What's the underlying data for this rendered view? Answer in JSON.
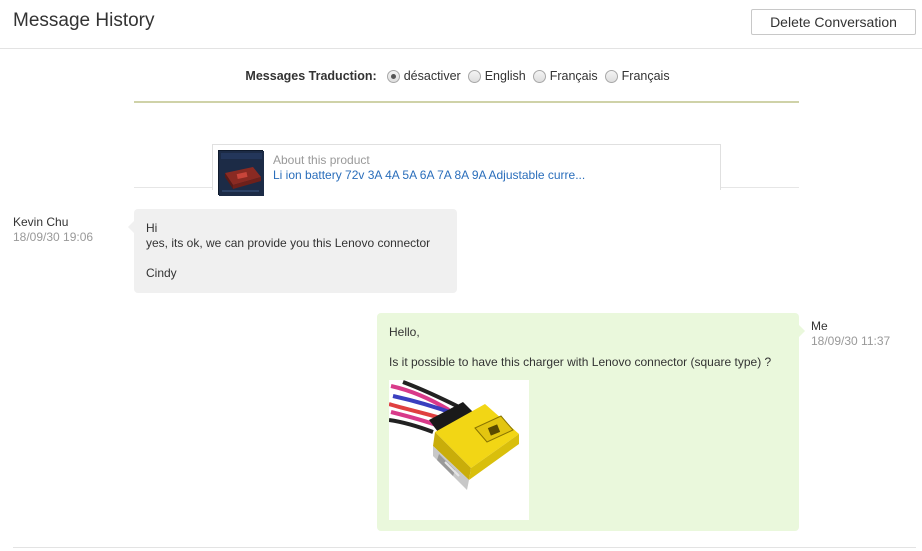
{
  "header": {
    "title": "Message History",
    "delete_label": "Delete Conversation"
  },
  "translation": {
    "label": "Messages Traduction:",
    "options": [
      {
        "label": "désactiver",
        "checked": true
      },
      {
        "label": "English",
        "checked": false
      },
      {
        "label": "Français",
        "checked": false
      },
      {
        "label": "Français",
        "checked": false
      }
    ]
  },
  "product": {
    "about": "About this product",
    "link": "Li ion battery 72v 3A 4A 5A 6A 7A 8A 9A Adjustable curre..."
  },
  "messages": [
    {
      "sender": "Kevin Chu",
      "time": "18/09/30 19:06",
      "lines": [
        "Hi",
        "yes, its ok, we can provide you this Lenovo connector",
        "",
        "Cindy"
      ]
    },
    {
      "sender": "Me",
      "time": "18/09/30 11:37",
      "lines": [
        "Hello,",
        "",
        "Is it possible to have this charger with Lenovo connector (square type) ?"
      ]
    }
  ],
  "colors": {
    "incoming_bubble": "#f0f0f0",
    "outgoing_bubble": "#eaf8dc",
    "link": "#2a6ebb",
    "connector_yellow": "#f2d615"
  }
}
